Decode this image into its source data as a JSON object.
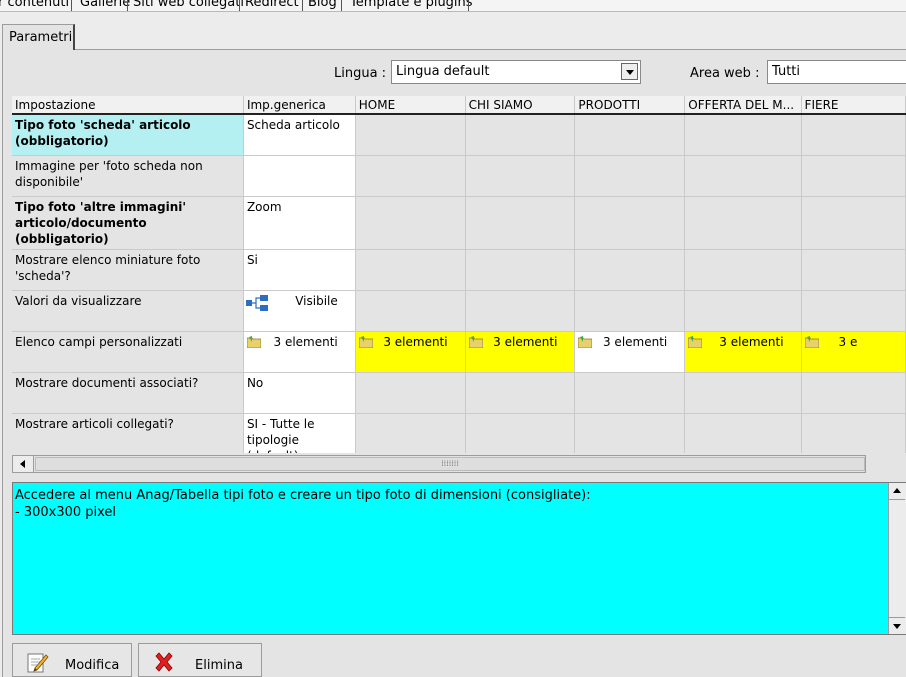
{
  "top_menu": [
    "r contenuti",
    "Gallerie",
    "Siti web collegati",
    "Redirect",
    "Blog",
    "Template e plugins"
  ],
  "tab": {
    "label": "Parametri"
  },
  "filters": {
    "lingua_label": "Lingua :",
    "lingua_value": "Lingua default",
    "area_label": "Area web :",
    "area_value": "Tutti"
  },
  "grid": {
    "headers": [
      "Impostazione",
      "Imp.generica",
      "HOME",
      "CHI SIAMO",
      "PRODOTTI",
      "OFFERTA DEL M...",
      "FIERE"
    ],
    "rows": [
      {
        "setting": "Tipo foto 'scheda' articolo (obbligatorio)",
        "generic": "Scheda articolo"
      },
      {
        "setting": "Immagine per 'foto scheda non disponibile'",
        "generic": ""
      },
      {
        "setting": "Tipo foto 'altre immagini' articolo/documento (obbligatorio)",
        "generic": "Zoom"
      },
      {
        "setting": "Mostrare elenco miniature foto 'scheda'?",
        "generic": "Si"
      },
      {
        "setting": "Valori da visualizzare",
        "generic": "Visibile"
      },
      {
        "setting": "Elenco campi personalizzati",
        "generic": "3 elementi",
        "per_area": [
          "3 elementi",
          "3 elementi",
          "3 elementi",
          "3 elementi",
          "3 e"
        ]
      },
      {
        "setting": "Mostrare documenti associati?",
        "generic": "No"
      },
      {
        "setting": "Mostrare articoli collegati?",
        "generic": "SI - Tutte le tipologie (default)"
      }
    ]
  },
  "description": {
    "text": "Accedere al menu Anag/Tabella tipi foto e creare un tipo foto di dimensioni (consigliate):\n- 300x300 pixel"
  },
  "buttons": {
    "modifica": "Modifica",
    "elimina": "Elimina"
  },
  "colors": {
    "selected_cell": "#b4f0f2",
    "highlight_yellow": "#ffff00",
    "description_bg": "#00ffff"
  }
}
